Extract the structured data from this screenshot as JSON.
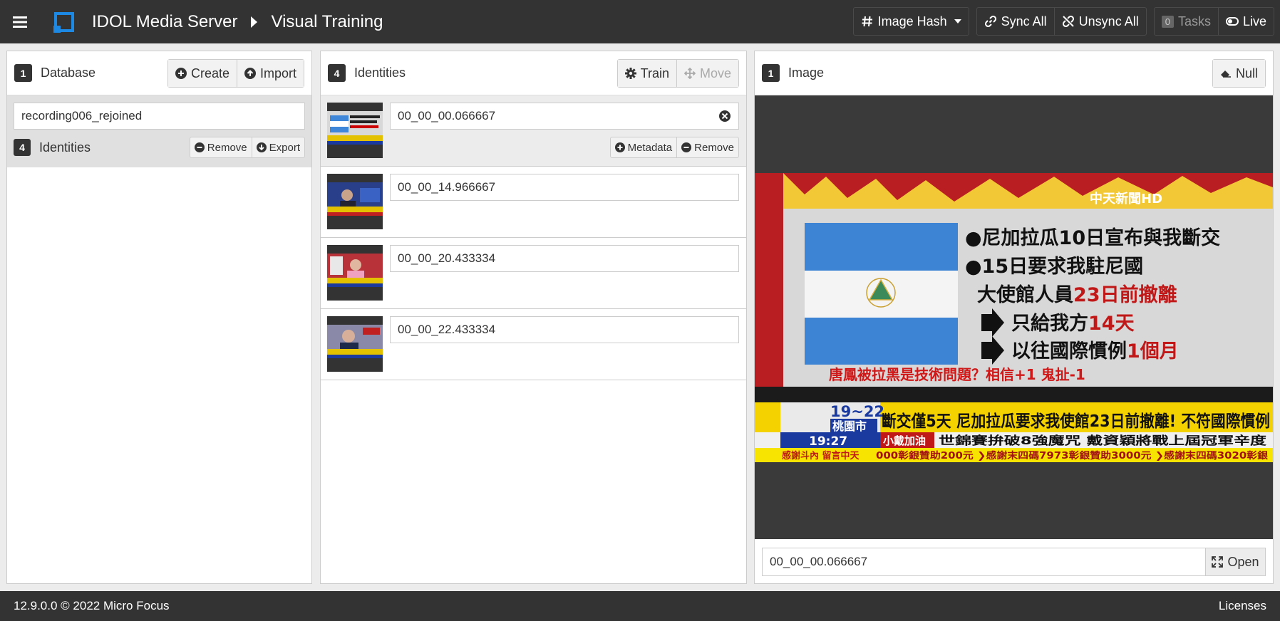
{
  "header": {
    "app_title": "IDOL Media Server",
    "page_title": "Visual Training",
    "analysis_select": "Image Hash",
    "sync_all": "Sync All",
    "unsync_all": "Unsync All",
    "tasks_count": "0",
    "tasks": "Tasks",
    "live": "Live"
  },
  "database_panel": {
    "count": "1",
    "title": "Database",
    "create": "Create",
    "import": "Import",
    "db_name": "recording006_rejoined",
    "identities_count": "4",
    "identities_label": "Identities",
    "remove": "Remove",
    "export": "Export"
  },
  "identities_panel": {
    "count": "4",
    "title": "Identities",
    "train": "Train",
    "move": "Move",
    "metadata": "Metadata",
    "remove": "Remove",
    "items": [
      {
        "name": "00_00_00.066667"
      },
      {
        "name": "00_00_14.966667"
      },
      {
        "name": "00_00_20.433334"
      },
      {
        "name": "00_00_22.433334"
      }
    ]
  },
  "image_panel": {
    "count": "1",
    "title": "Image",
    "null": "Null",
    "image_name": "00_00_00.066667",
    "open": "Open",
    "screenshot": {
      "logo": "中天新聞HD",
      "bullet1": "●尼加拉瓜10日宣布與我斷交",
      "bullet2": "●15日要求我駐尼國",
      "bullet3a": "大使館人員",
      "bullet3b": "23日前撤離",
      "arrow1a": "只給我方",
      "arrow1b": "14天",
      "arrow2a": "以往國際慣例",
      "arrow2b": "1個月",
      "comment": "唐鳳被拉黑是技術問題？相信+1 鬼扯-1",
      "temp": "19~22",
      "city": "桃園市",
      "time": "19:27",
      "headline": "斷交僅5天 尼加拉瓜要求我使館23日前撤離! 不符國際慣例",
      "ticker_tag": "小戴加油",
      "ticker": "世錦賽拚破8強魔咒 戴資穎將戰上屆冠軍辛度",
      "scroll_tag": "感謝斗內 留言中天",
      "scroll": "000彰銀贊助200元 ❯感謝末四碼7973彰銀贊助3000元 ❯感謝末四碼3020彰銀"
    }
  },
  "footer": {
    "version": "12.9.0.0 © 2022 Micro Focus",
    "licenses": "Licenses"
  }
}
